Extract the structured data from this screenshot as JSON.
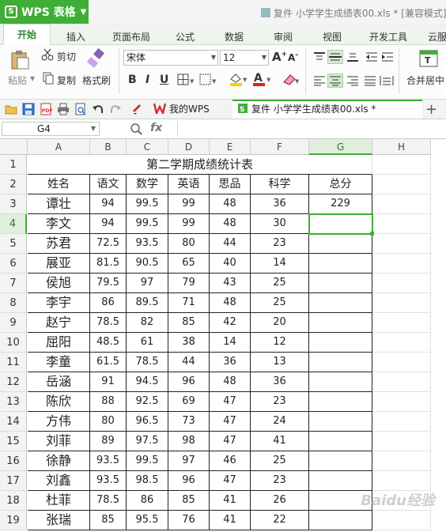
{
  "titlebar": {
    "app_menu_label": "WPS 表格",
    "doc_title": "复件 小学学生成绩表00.xls * [兼容模式]"
  },
  "ribbon_tabs": [
    "开始",
    "插入",
    "页面布局",
    "公式",
    "数据",
    "审阅",
    "视图",
    "开发工具",
    "云服务"
  ],
  "ribbon": {
    "paste": "粘贴",
    "cut": "剪切",
    "copy": "复制",
    "format_painter": "格式刷",
    "font_name": "宋体",
    "font_size": "12",
    "bold": "B",
    "italic": "I",
    "underline": "U",
    "grow_font": "A+",
    "shrink_font": "A-",
    "merge_center": "合并居中"
  },
  "doc_tabs": {
    "mywps": "我的WPS",
    "file": "复件 小学学生成绩表00.xls *"
  },
  "formula_bar": {
    "name_box": "G4",
    "fx": "fx",
    "formula": ""
  },
  "columns": [
    "A",
    "B",
    "C",
    "D",
    "E",
    "F",
    "G",
    "H"
  ],
  "selected_column": "G",
  "selected_row": 4,
  "row_numbers": [
    1,
    2,
    3,
    4,
    5,
    6,
    7,
    8,
    9,
    10,
    11,
    12,
    13,
    14,
    15,
    16,
    17,
    18,
    19
  ],
  "sheet": {
    "title": "第二学期成绩统计表",
    "headers": [
      "姓名",
      "语文",
      "数学",
      "英语",
      "思品",
      "科学",
      "总分"
    ],
    "rows": [
      [
        "谭壮",
        "94",
        "99.5",
        "99",
        "48",
        "36",
        "229"
      ],
      [
        "李文",
        "94",
        "99.5",
        "99",
        "48",
        "30",
        ""
      ],
      [
        "苏君",
        "72.5",
        "93.5",
        "80",
        "44",
        "23",
        ""
      ],
      [
        "展亚",
        "81.5",
        "90.5",
        "65",
        "40",
        "14",
        ""
      ],
      [
        "侯旭",
        "79.5",
        "97",
        "79",
        "43",
        "25",
        ""
      ],
      [
        "李宇",
        "86",
        "89.5",
        "71",
        "48",
        "25",
        ""
      ],
      [
        "赵宁",
        "78.5",
        "82",
        "85",
        "42",
        "20",
        ""
      ],
      [
        "屈阳",
        "48.5",
        "61",
        "38",
        "14",
        "12",
        ""
      ],
      [
        "李童",
        "61.5",
        "78.5",
        "44",
        "36",
        "13",
        ""
      ],
      [
        "岳涵",
        "91",
        "94.5",
        "96",
        "48",
        "36",
        ""
      ],
      [
        "陈欣",
        "88",
        "92.5",
        "69",
        "47",
        "23",
        ""
      ],
      [
        "方伟",
        "80",
        "96.5",
        "73",
        "47",
        "24",
        ""
      ],
      [
        "刘菲",
        "89",
        "97.5",
        "98",
        "47",
        "41",
        ""
      ],
      [
        "徐静",
        "93.5",
        "99.5",
        "97",
        "46",
        "25",
        ""
      ],
      [
        "刘鑫",
        "93.5",
        "98.5",
        "96",
        "47",
        "23",
        ""
      ],
      [
        "杜菲",
        "78.5",
        "86",
        "85",
        "41",
        "26",
        ""
      ],
      [
        "张瑞",
        "85",
        "95.5",
        "76",
        "41",
        "22",
        ""
      ]
    ]
  },
  "watermark": "Baidu经验",
  "colors": {
    "accent": "#3fae36",
    "selected_header": "#dfeedd"
  }
}
